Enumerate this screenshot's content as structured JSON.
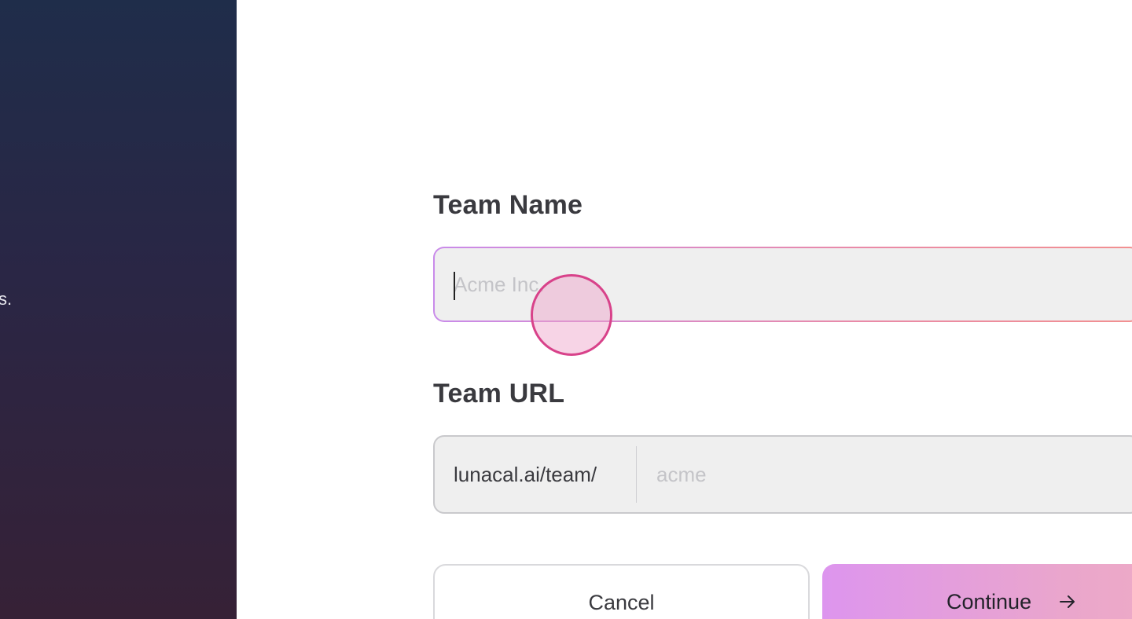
{
  "left_panel": {
    "text_fragment": "s."
  },
  "form": {
    "team_name": {
      "label": "Team Name",
      "placeholder": "Acme Inc.",
      "value": ""
    },
    "team_url": {
      "label": "Team URL",
      "prefix": "lunacal.ai/team/",
      "placeholder": "acme",
      "value": ""
    }
  },
  "actions": {
    "cancel_label": "Cancel",
    "continue_label": "Continue",
    "continue_icon": "arrow-right-icon"
  },
  "colors": {
    "left_panel_top": "#1f2d4a",
    "left_panel_bottom": "#362136",
    "field_border_gradient_start": "#c98bea",
    "field_border_gradient_end": "#f29090",
    "continue_gradient_start": "#dd95ee",
    "continue_gradient_end": "#f4b1bd",
    "click_indicator": "#d8428a"
  }
}
